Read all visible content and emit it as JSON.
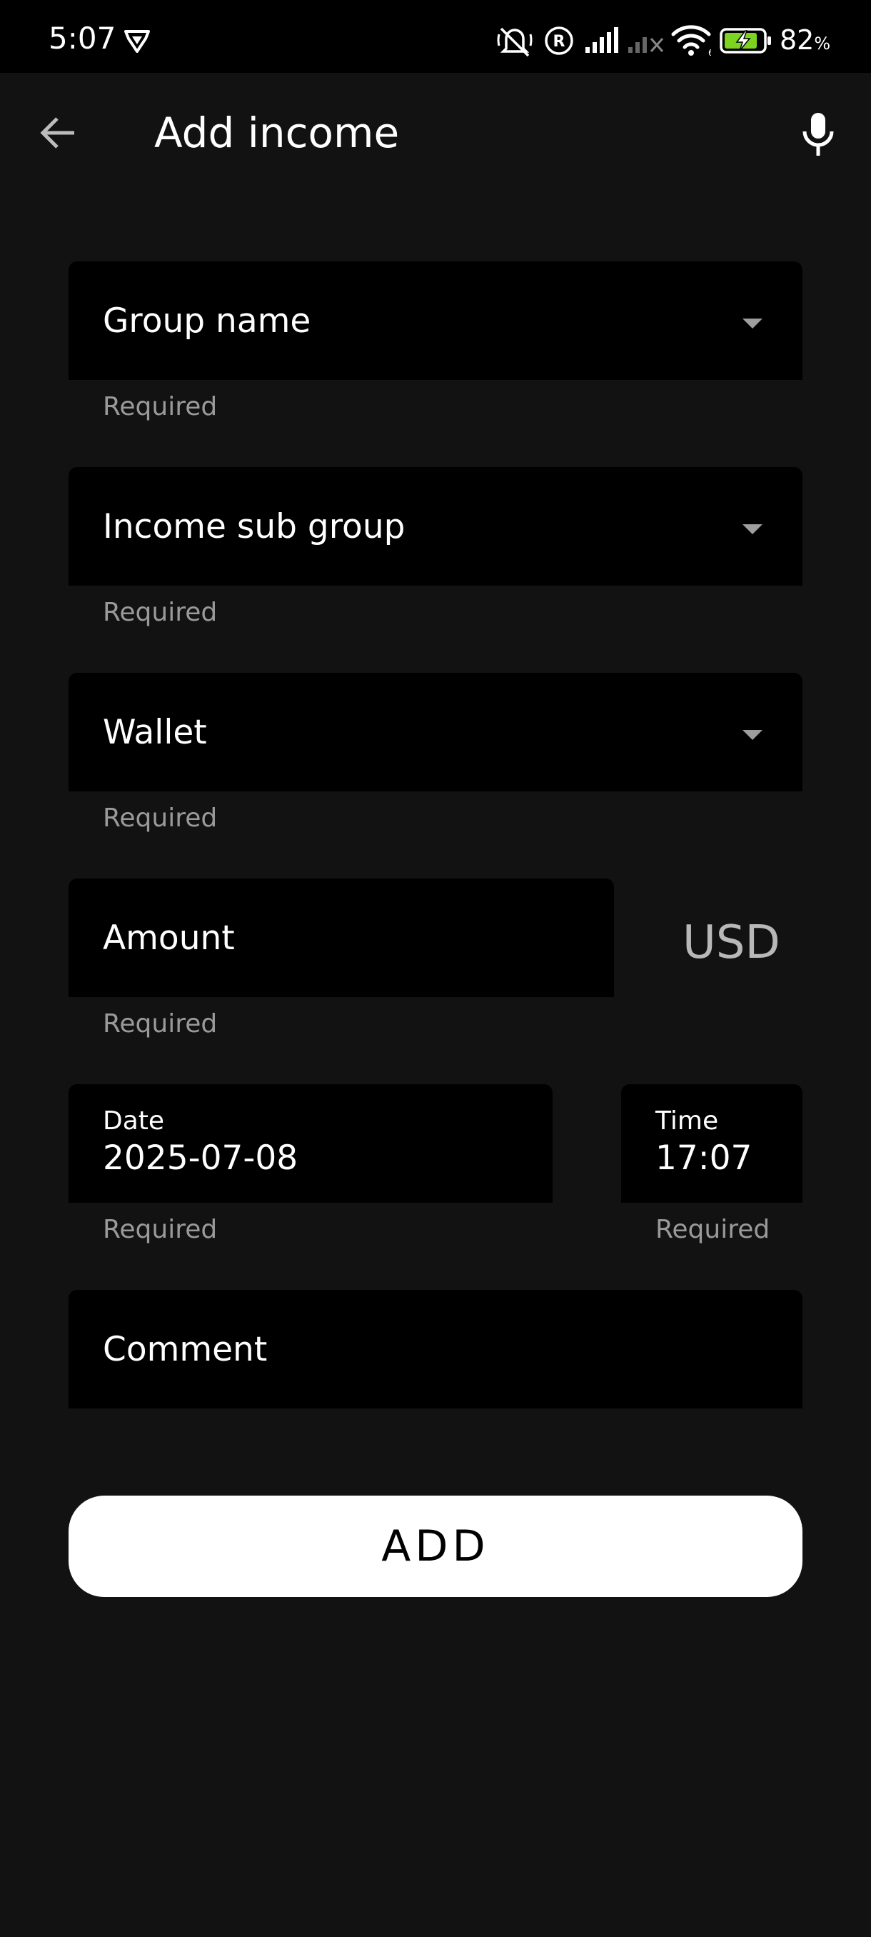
{
  "status_bar": {
    "time": "5:07",
    "battery_percent": "82",
    "battery_unit": "%",
    "battery_level": 0.82,
    "icons": [
      "vpn-shield-icon",
      "mute-icon",
      "registered-icon",
      "signal-icon",
      "no-signal-icon",
      "wifi-icon",
      "battery-charging-icon"
    ]
  },
  "app_bar": {
    "title": "Add income",
    "back_icon": "arrow-back-icon",
    "mic_icon": "microphone-icon"
  },
  "form": {
    "group_name": {
      "label": "Group name",
      "helper": "Required"
    },
    "sub_group": {
      "label": "Income sub group",
      "helper": "Required"
    },
    "wallet": {
      "label": "Wallet",
      "helper": "Required"
    },
    "amount": {
      "label": "Amount",
      "helper": "Required",
      "currency": "USD"
    },
    "date": {
      "label": "Date",
      "value": "2025-07-08",
      "helper": "Required"
    },
    "time": {
      "label": "Time",
      "value": "17:07",
      "helper": "Required"
    },
    "comment": {
      "label": "Comment"
    }
  },
  "actions": {
    "add_label": "ADD"
  },
  "colors": {
    "background": "#121212",
    "field_background": "#000000",
    "helper_text": "#9a9a9a",
    "button_background": "#ffffff",
    "battery_fill": "#7ed321"
  }
}
